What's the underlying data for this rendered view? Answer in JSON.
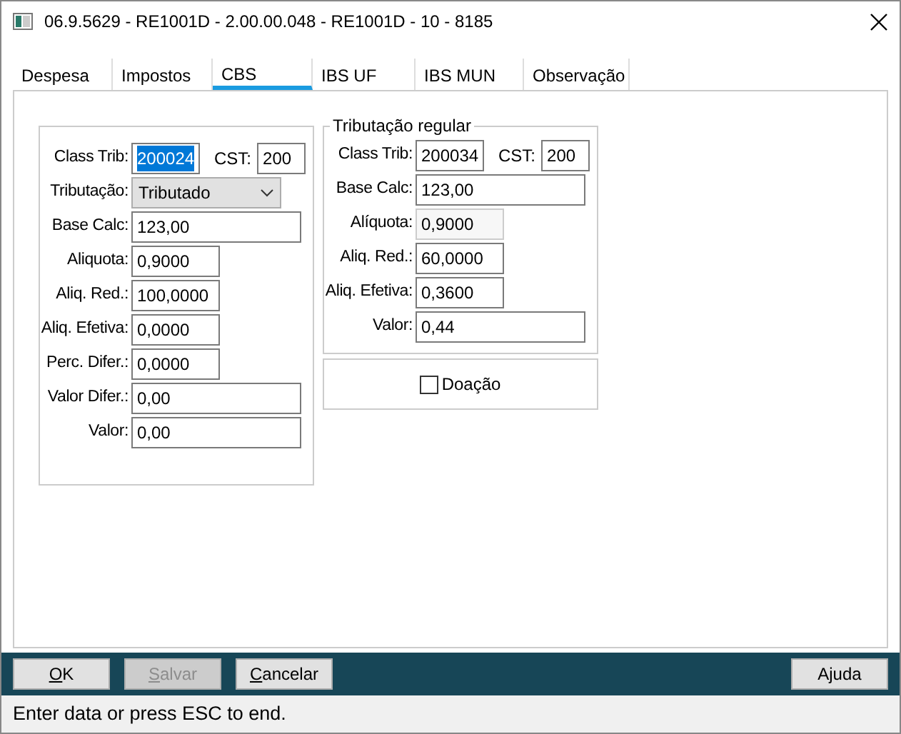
{
  "window": {
    "title": "06.9.5629 - RE1001D - 2.00.00.048 - RE1001D - 10 - 8185"
  },
  "tabs": [
    {
      "label": "Despesa",
      "selected": false
    },
    {
      "label": "Impostos",
      "selected": false
    },
    {
      "label": "CBS",
      "selected": true
    },
    {
      "label": "IBS UF",
      "selected": false
    },
    {
      "label": "IBS MUN",
      "selected": false
    },
    {
      "label": "Observação",
      "selected": false
    }
  ],
  "main_group": {
    "fields": [
      {
        "kind": "pair",
        "label": "Class Trib:",
        "value": "200024",
        "highlighted": true,
        "label_2": "CST:",
        "value_2": "200"
      },
      {
        "kind": "select",
        "label": "Tributação:",
        "value": "Tributado"
      },
      {
        "kind": "wide",
        "label": "Base Calc:",
        "value": "123,00"
      },
      {
        "kind": "narrow",
        "label": "Aliquota:",
        "value": "0,9000"
      },
      {
        "kind": "narrow",
        "label": "Aliq. Red.:",
        "value": "100,0000"
      },
      {
        "kind": "narrow",
        "label": "Aliq. Efetiva:",
        "value": "0,0000"
      },
      {
        "kind": "narrow",
        "label": "Perc. Difer.:",
        "value": "0,0000"
      },
      {
        "kind": "wide",
        "label": "Valor Difer.:",
        "value": "0,00"
      },
      {
        "kind": "wide",
        "label": "Valor:",
        "value": "0,00"
      }
    ]
  },
  "regular_group": {
    "title": "Tributação regular",
    "fields": [
      {
        "kind": "pair",
        "label": "Class Trib:",
        "value": "200034",
        "highlighted": false,
        "label_2": "CST:",
        "value_2": "200"
      },
      {
        "kind": "wide",
        "label": "Base Calc:",
        "value": "123,00"
      },
      {
        "kind": "narrow",
        "label": "Alíquota:",
        "value": "0,9000",
        "disabled": true
      },
      {
        "kind": "narrow",
        "label": "Aliq. Red.:",
        "value": "60,0000",
        "disabled": false
      },
      {
        "kind": "narrow",
        "label": "Aliq. Efetiva:",
        "value": "0,3600",
        "disabled": false
      },
      {
        "kind": "wide",
        "label": "Valor:",
        "value": "0,44"
      }
    ]
  },
  "donation": {
    "label": "Doação",
    "checked": false
  },
  "buttons": [
    {
      "accel": "O",
      "rest": "K",
      "disabled": false
    },
    {
      "accel": "S",
      "rest": "alvar",
      "disabled": true
    },
    {
      "accel": "C",
      "rest": "ancelar",
      "disabled": false
    },
    {
      "rest": "Ajuda",
      "disabled": false
    }
  ],
  "status_bar": "Enter data or press ESC to end."
}
